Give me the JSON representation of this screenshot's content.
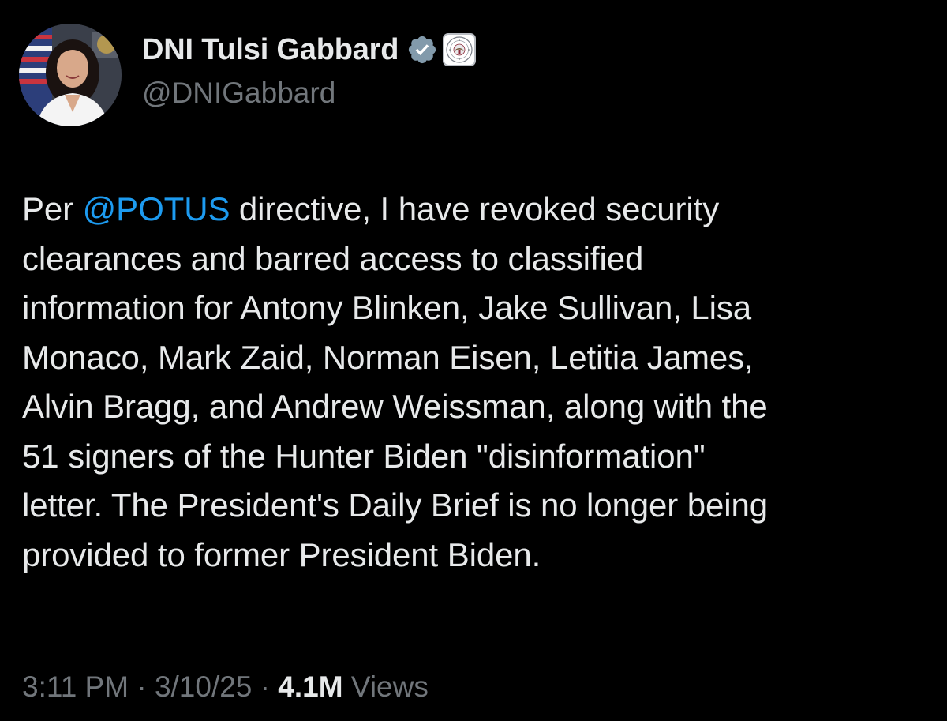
{
  "author": {
    "display_name": "DNI Tulsi Gabbard",
    "handle": "@DNIGabbard",
    "avatar": "profile-photo",
    "verified_icon": "verified-badge-icon",
    "verified_color": "#829aab",
    "affiliation_badge": "odni-seal-icon"
  },
  "tweet": {
    "lines": [
      {
        "before": "Per ",
        "mention": "@POTUS",
        "after": " directive, I have revoked security"
      },
      {
        "text": "clearances and barred access to classified"
      },
      {
        "text": "information for Antony Blinken, Jake Sullivan, Lisa"
      },
      {
        "text": "Monaco, Mark Zaid, Norman Eisen, Letitia James,"
      },
      {
        "text": "Alvin Bragg, and Andrew Weissman, along with the"
      },
      {
        "text": "51 signers of the Hunter Biden \"disinformation\""
      },
      {
        "text": "letter. The President's Daily Brief is no longer being"
      },
      {
        "text": "provided to former President Biden."
      }
    ]
  },
  "meta": {
    "time": "3:11 PM",
    "separator": " · ",
    "date": "3/10/25",
    "views_count": "4.1M",
    "views_label": " Views"
  },
  "colors": {
    "background": "#000000",
    "text": "#e7e9ea",
    "secondary": "#71767b",
    "mention": "#1d9bf0"
  }
}
